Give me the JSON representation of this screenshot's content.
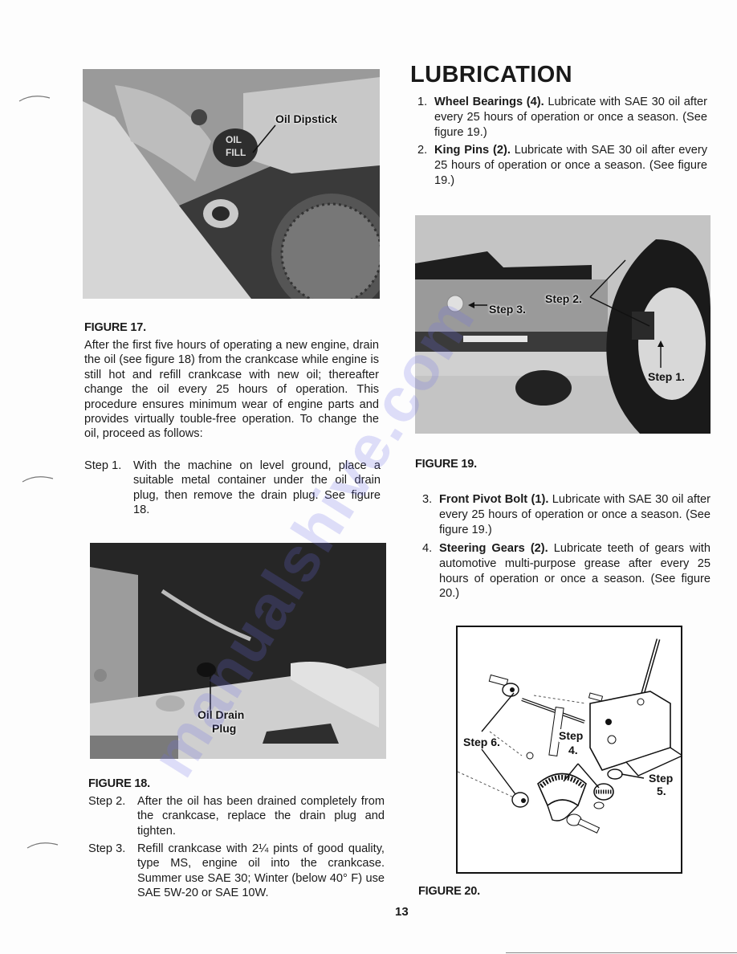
{
  "page": {
    "page_number": "13",
    "watermark": "manualshive.com",
    "colors": {
      "ink": "#1a1a1a",
      "paper": "#fdfdfd",
      "watermark": "#6e6ee6"
    }
  },
  "left_column": {
    "figure17": {
      "caption": "FIGURE 17.",
      "callouts": {
        "oil_dipstick": "Oil Dipstick",
        "cap_text_line1": "OIL",
        "cap_text_line2": "FILL"
      }
    },
    "intro_paragraph": "After the first five hours of operating a new engine, drain the oil (see figure 18) from the crankcase while engine is still hot and refill crankcase with new oil; thereafter change the oil every 25 hours of operation. This procedure ensures minimum wear of engine parts and provides virtually touble-free operation. To change the oil, proceed as follows:",
    "steps_before": [
      {
        "label": "Step 1.",
        "text": "With the machine on level ground, place a suitable metal container under the oil drain plug, then remove the drain plug. See figure 18."
      }
    ],
    "figure18": {
      "caption": "FIGURE 18.",
      "callouts": {
        "drain_line1": "Oil Drain",
        "drain_line2": "Plug"
      }
    },
    "steps_after": [
      {
        "label": "Step 2.",
        "text": "After the oil has been drained completely from the crankcase, replace the drain plug and tighten."
      },
      {
        "label": "Step 3.",
        "text": "Refill crankcase with 2¼ pints of good quality, type MS, engine oil into the crankcase. Summer use SAE 30; Winter (below 40° F) use SAE 5W-20 or SAE 10W."
      }
    ]
  },
  "right_column": {
    "heading": "LUBRICATION",
    "items_top": [
      {
        "num": "1.",
        "lead": "Wheel Bearings (4).",
        "text": " Lubricate with SAE 30 oil after every 25 hours of operation or once a season. (See figure 19.)"
      },
      {
        "num": "2.",
        "lead": "King Pins (2).",
        "text": " Lubricate with SAE 30 oil after every 25 hours of operation or once a season. (See figure 19.)"
      }
    ],
    "figure19": {
      "caption": "FIGURE 19.",
      "callouts": {
        "step1": "Step 1.",
        "step2": "Step 2.",
        "step3": "Step 3."
      }
    },
    "items_bottom": [
      {
        "num": "3.",
        "lead": "Front Pivot Bolt (1).",
        "text": " Lubricate with SAE 30 oil after every 25 hours of operation or once a season. (See figure 19.)"
      },
      {
        "num": "4.",
        "lead": "Steering Gears (2).",
        "text": " Lubricate teeth of gears with automotive multi-purpose grease after every 25 hours of operation or once a season. (See figure 20.)"
      }
    ],
    "figure20": {
      "caption": "FIGURE 20.",
      "callouts": {
        "step4_line1": "Step",
        "step4_line2": "4.",
        "step5_line1": "Step",
        "step5_line2": "5.",
        "step6": "Step 6."
      }
    }
  }
}
